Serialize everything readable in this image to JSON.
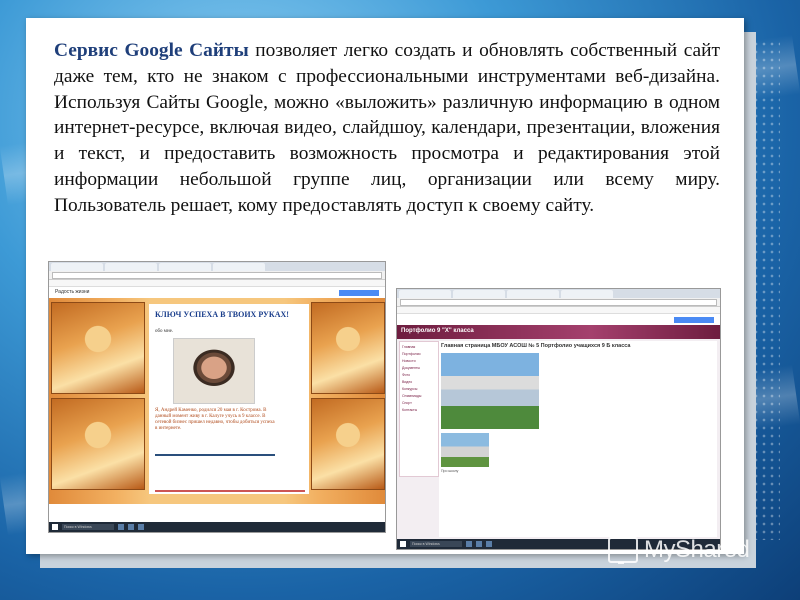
{
  "slide": {
    "highlight": "Сервис Google Сайты",
    "paragraph": " позволяет легко создать и обновлять собственный сайт даже тем, кто не знаком с профессиональными инструментами веб-дизайна. Используя Сайты Google, можно «выложить» различную информацию в одном интернет-ресурсе, включая видео, слайдшоу, календари, презентации, вложения и текст, и предоставить возможность просмотра и редактирования этой информации небольшой группе лиц, организации или всему миру. Пользователь решает, кому предоставлять доступ к своему сайту."
  },
  "screenshot1": {
    "site_title": "Радость жизни",
    "site_title_description": "Этот сайт предназначен для родителей и учеников",
    "page_title": "КЛЮЧ УСПЕХА В ТВОИХ РУКАХ!",
    "about_label": "обо мне.",
    "bio": "Я, Андрей Каменко, родился 20 мая в г. Костромa. В данный момент живу в г. Калуге учусь в 9 классе. В сетевой бизнес пришел недавно, чтобы добиться успеха в интернете.",
    "footer_link": "Контакты/о"
  },
  "screenshot2": {
    "banner": "Портфолио 9 \"Х\" класса",
    "page_heading": "Главная страница МБОУ АСОШ № 5 Портфолио учащихся 9 Б класса",
    "caption": "Про школу",
    "nav_items": [
      "Главная",
      "Портфолио",
      "Новости",
      "Документы",
      "Фото",
      "Видео",
      "Конкурсы",
      "Олимпиады",
      "Спорт",
      "Контакты"
    ]
  },
  "browser": {
    "search_placeholder": "Поиск в Windows"
  },
  "watermark": {
    "text": "MyShared"
  }
}
